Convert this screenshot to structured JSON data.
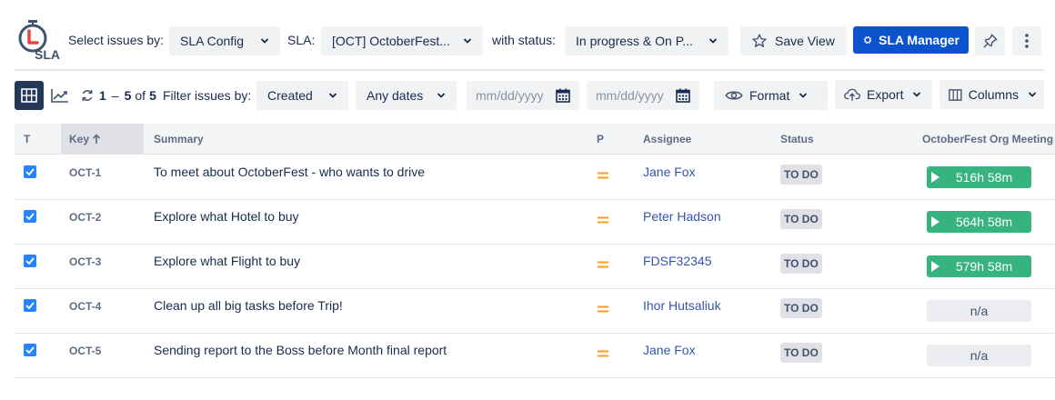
{
  "header": {
    "logo_text": "SLA",
    "select_label": "Select issues by:",
    "select_value": "SLA Config",
    "sla_label": "SLA:",
    "sla_value": "[OCT] OctoberFest...",
    "status_label": "with status:",
    "status_value": "In progress & On P...",
    "save_view_label": "Save View",
    "sla_manager_label": "SLA Manager"
  },
  "filters": {
    "pagination_start": "1",
    "pagination_dash": "–",
    "pagination_end": "5",
    "pagination_of": "of",
    "pagination_total": "5",
    "filter_label": "Filter issues by:",
    "field_value": "Created",
    "range_value": "Any dates",
    "date_from_placeholder": "mm/dd/yyyy",
    "date_to_placeholder": "mm/dd/yyyy",
    "format_label": "Format",
    "export_label": "Export",
    "columns_label": "Columns"
  },
  "table": {
    "columns": {
      "type": "T",
      "key": "Key",
      "summary": "Summary",
      "priority": "P",
      "assignee": "Assignee",
      "status": "Status",
      "sla": "OctoberFest Org Meeting"
    },
    "rows": [
      {
        "key": "OCT-1",
        "summary": "To meet about OctoberFest - who wants to drive",
        "assignee": "Jane Fox",
        "status": "TO DO",
        "sla": "516h 58m",
        "sla_running": true
      },
      {
        "key": "OCT-2",
        "summary": "Explore what Hotel to buy",
        "assignee": "Peter Hadson",
        "status": "TO DO",
        "sla": "564h 58m",
        "sla_running": true
      },
      {
        "key": "OCT-3",
        "summary": "Explore what Flight to buy",
        "assignee": "FDSF32345",
        "status": "TO DO",
        "sla": "579h 58m",
        "sla_running": true
      },
      {
        "key": "OCT-4",
        "summary": "Clean up all big tasks before Trip!",
        "assignee": "Ihor Hutsaliuk",
        "status": "TO DO",
        "sla": "n/a",
        "sla_running": false
      },
      {
        "key": "OCT-5",
        "summary": "Sending report to the Boss before Month final report",
        "assignee": "Jane Fox",
        "status": "TO DO",
        "sla": "n/a",
        "sla_running": false
      }
    ]
  },
  "colors": {
    "primary": "#0c52cc",
    "sla_running": "#36b37e",
    "priority_medium": "#ff991f",
    "link": "#3355aa"
  }
}
